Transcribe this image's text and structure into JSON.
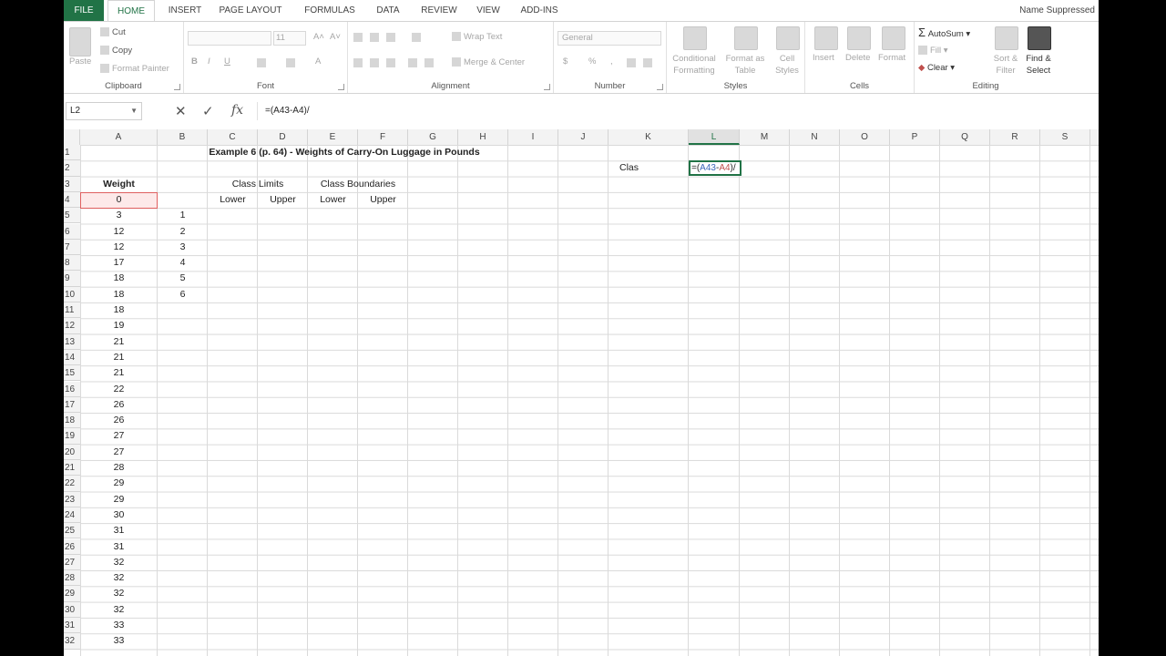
{
  "tabs": [
    "FILE",
    "HOME",
    "INSERT",
    "PAGE LAYOUT",
    "FORMULAS",
    "DATA",
    "REVIEW",
    "VIEW",
    "ADD-INS"
  ],
  "user_name": "Name Suppressed",
  "ribbon": {
    "clipboard": {
      "label": "Clipboard",
      "paste": "Paste",
      "cut": "Cut",
      "copy": "Copy",
      "format_painter": "Format Painter"
    },
    "font": {
      "label": "Font",
      "size": "11",
      "bold": "B",
      "italic": "I",
      "underline": "U"
    },
    "alignment": {
      "label": "Alignment",
      "wrap_text": "Wrap Text",
      "merge_center": "Merge & Center"
    },
    "number": {
      "label": "Number",
      "format": "General",
      "currency": "$",
      "percent": "%"
    },
    "styles": {
      "label": "Styles",
      "conditional": "Conditional Formatting",
      "format_table": "Format as Table",
      "cell_styles": "Cell Styles"
    },
    "cells": {
      "label": "Cells",
      "insert": "Insert",
      "delete": "Delete",
      "format": "Format"
    },
    "editing": {
      "label": "Editing",
      "autosum": "AutoSum",
      "fill": "Fill",
      "clear": "Clear",
      "sort": "Sort & Filter",
      "find": "Find & Select"
    }
  },
  "formula_bar": {
    "name_box": "L2",
    "cancel": "✕",
    "enter": "✓",
    "fx": "fx",
    "formula": "=(A43-A4)/"
  },
  "columns": [
    "A",
    "B",
    "C",
    "D",
    "E",
    "F",
    "G",
    "H",
    "I",
    "J",
    "K",
    "L",
    "M",
    "N",
    "O",
    "P",
    "Q",
    "R",
    "S"
  ],
  "selected_column": "L",
  "rows": [
    "1",
    "2",
    "3",
    "4",
    "5",
    "6",
    "7",
    "8",
    "9",
    "10",
    "11",
    "12",
    "13",
    "14",
    "15",
    "16",
    "17",
    "18",
    "19",
    "20",
    "21",
    "22",
    "23",
    "24",
    "25",
    "26",
    "27",
    "28",
    "29",
    "30",
    "31",
    "32"
  ],
  "sheet": {
    "title": "Example 6 (p. 64) - Weights of Carry-On Luggage in Pounds",
    "weight_header": "Weight",
    "class_limits": "Class Limits",
    "class_boundaries": "Class Boundaries",
    "lower1": "Lower",
    "upper1": "Upper",
    "lower2": "Lower",
    "upper2": "Upper",
    "k2_label": "Clas",
    "l2_edit": {
      "prefix": "=(",
      "ref1": "A43",
      "dash": "-",
      "ref2": "A4",
      "suffix": ")/"
    },
    "weights": [
      "0",
      "3",
      "12",
      "12",
      "17",
      "18",
      "18",
      "18",
      "19",
      "21",
      "21",
      "21",
      "22",
      "26",
      "26",
      "27",
      "27",
      "28",
      "29",
      "29",
      "30",
      "31",
      "31",
      "32",
      "32",
      "32",
      "32",
      "33",
      "33"
    ],
    "classes": [
      "1",
      "2",
      "3",
      "4",
      "5",
      "6"
    ]
  }
}
